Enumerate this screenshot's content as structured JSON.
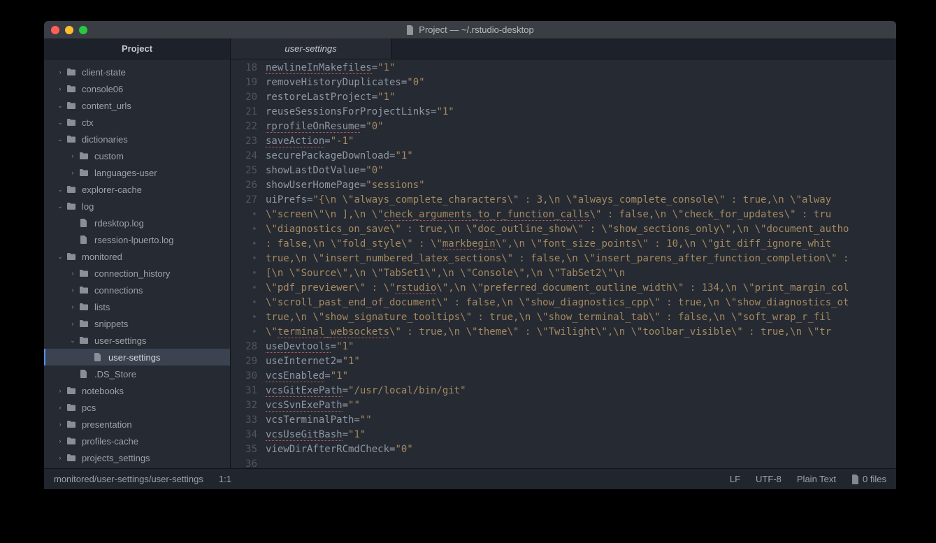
{
  "window_title": "Project — ~/.rstudio-desktop",
  "sidebar_title": "Project",
  "tab_label": "user-settings",
  "tree": [
    {
      "depth": 0,
      "type": "folder",
      "open": 0,
      "chev": ">",
      "label": "client-state"
    },
    {
      "depth": 0,
      "type": "folder",
      "open": 0,
      "chev": ">",
      "label": "console06"
    },
    {
      "depth": 0,
      "type": "folder",
      "open": 1,
      "chev": "v",
      "label": "content_urls"
    },
    {
      "depth": 0,
      "type": "folder",
      "open": 1,
      "chev": "v",
      "label": "ctx"
    },
    {
      "depth": 0,
      "type": "folder",
      "open": 1,
      "chev": "v",
      "label": "dictionaries"
    },
    {
      "depth": 1,
      "type": "folder",
      "open": 0,
      "chev": ">",
      "label": "custom"
    },
    {
      "depth": 1,
      "type": "folder",
      "open": 0,
      "chev": ">",
      "label": "languages-user"
    },
    {
      "depth": 0,
      "type": "folder",
      "open": 1,
      "chev": "v",
      "label": "explorer-cache"
    },
    {
      "depth": 0,
      "type": "folder",
      "open": 1,
      "chev": "v",
      "label": "log"
    },
    {
      "depth": 1,
      "type": "file",
      "chev": "",
      "label": "rdesktop.log"
    },
    {
      "depth": 1,
      "type": "file",
      "chev": "",
      "label": "rsession-lpuerto.log"
    },
    {
      "depth": 0,
      "type": "folder",
      "open": 1,
      "chev": "v",
      "label": "monitored"
    },
    {
      "depth": 1,
      "type": "folder",
      "open": 0,
      "chev": ">",
      "label": "connection_history"
    },
    {
      "depth": 1,
      "type": "folder",
      "open": 0,
      "chev": ">",
      "label": "connections"
    },
    {
      "depth": 1,
      "type": "folder",
      "open": 0,
      "chev": ">",
      "label": "lists"
    },
    {
      "depth": 1,
      "type": "folder",
      "open": 0,
      "chev": ">",
      "label": "snippets"
    },
    {
      "depth": 1,
      "type": "folder",
      "open": 1,
      "chev": "v",
      "label": "user-settings"
    },
    {
      "depth": 2,
      "type": "file",
      "chev": "",
      "label": "user-settings",
      "active": true
    },
    {
      "depth": 1,
      "type": "file",
      "chev": "",
      "label": ".DS_Store"
    },
    {
      "depth": 0,
      "type": "folder",
      "open": 0,
      "chev": ">",
      "label": "notebooks"
    },
    {
      "depth": 0,
      "type": "folder",
      "open": 0,
      "chev": ">",
      "label": "pcs"
    },
    {
      "depth": 0,
      "type": "folder",
      "open": 0,
      "chev": ">",
      "label": "presentation"
    },
    {
      "depth": 0,
      "type": "folder",
      "open": 0,
      "chev": ">",
      "label": "profiles-cache"
    },
    {
      "depth": 0,
      "type": "folder",
      "open": 0,
      "chev": ">",
      "label": "projects_settings"
    }
  ],
  "code": [
    {
      "n": "18",
      "seg": [
        {
          "t": "newlineInMakefiles",
          "s": 1
        },
        {
          "t": "="
        },
        {
          "t": "\"1\"",
          "c": "str"
        }
      ]
    },
    {
      "n": "19",
      "seg": [
        {
          "t": "removeHistoryDuplicates="
        },
        {
          "t": "\"0\"",
          "c": "str"
        }
      ]
    },
    {
      "n": "20",
      "seg": [
        {
          "t": "restoreLastProject="
        },
        {
          "t": "\"1\"",
          "c": "str"
        }
      ]
    },
    {
      "n": "21",
      "seg": [
        {
          "t": "reuseSessionsForProjectLinks="
        },
        {
          "t": "\"1\"",
          "c": "str"
        }
      ]
    },
    {
      "n": "22",
      "seg": [
        {
          "t": "rprofileOnResume",
          "s": 1
        },
        {
          "t": "="
        },
        {
          "t": "\"0\"",
          "c": "str"
        }
      ]
    },
    {
      "n": "23",
      "seg": [
        {
          "t": "saveAction",
          "s": 1
        },
        {
          "t": "="
        },
        {
          "t": "\"-1\"",
          "c": "str"
        }
      ]
    },
    {
      "n": "24",
      "seg": [
        {
          "t": "securePackageDownload="
        },
        {
          "t": "\"1\"",
          "c": "str"
        }
      ]
    },
    {
      "n": "25",
      "seg": [
        {
          "t": "showLastDotValue="
        },
        {
          "t": "\"0\"",
          "c": "str"
        }
      ]
    },
    {
      "n": "26",
      "seg": [
        {
          "t": "showUserHomePage="
        },
        {
          "t": "\"sessions\"",
          "c": "str"
        }
      ]
    },
    {
      "n": "27",
      "seg": [
        {
          "t": "uiPrefs="
        },
        {
          "t": "\"{\\n    \\\"always_complete_characters\\\" : 3,\\n    \\\"always_complete_console\\\" : true,\\n    \\\"alway",
          "c": "str"
        }
      ]
    },
    {
      "n": "•",
      "seg": [
        {
          "t": "\\\"screen\\\"\\n    ],\\n    \\\"",
          "c": "str"
        },
        {
          "t": "check_arguments_to_r_function_calls",
          "c": "str",
          "s": 1
        },
        {
          "t": "\\\" : false,\\n    \\\"check_for_updates\\\" : tru",
          "c": "str"
        }
      ]
    },
    {
      "n": "•",
      "seg": [
        {
          "t": "\\\"diagnostics_on_save\\\" : true,\\n    \\\"doc_outline_show\\\" : \\\"show_sections_only\\\",\\n    \\\"document_autho",
          "c": "str"
        }
      ]
    },
    {
      "n": "•",
      "seg": [
        {
          "t": ": false,\\n    \\\"fold_style\\\" : \\\"",
          "c": "str"
        },
        {
          "t": "markbegin",
          "c": "str",
          "s": 1
        },
        {
          "t": "\\\",\\n    \\\"font_size_points\\\" : 10,\\n    \\\"git_diff_ignore_whit",
          "c": "str"
        }
      ]
    },
    {
      "n": "•",
      "seg": [
        {
          "t": "true,\\n    \\\"insert_numbered_latex_sections\\\" : false,\\n    \\\"insert_parens_after_function_completion\\\" :",
          "c": "str"
        }
      ]
    },
    {
      "n": "•",
      "seg": [
        {
          "t": "[\\n            \\\"Source\\\",\\n            \\\"TabSet1\\\",\\n            \\\"Console\\\",\\n            \\\"TabSet2\\\"\\n",
          "c": "str"
        }
      ]
    },
    {
      "n": "•",
      "seg": [
        {
          "t": "\\\"pdf_previewer\\\" : \\\"",
          "c": "str"
        },
        {
          "t": "rstudio",
          "c": "str",
          "s": 1
        },
        {
          "t": "\\\",\\n    \\\"preferred_document_outline_width\\\" : 134,\\n    \\\"print_margin_col",
          "c": "str"
        }
      ]
    },
    {
      "n": "•",
      "seg": [
        {
          "t": "\\\"scroll_past_end_of_document\\\" : false,\\n    \\\"show_diagnostics_cpp\\\" : true,\\n    \\\"show_diagnostics_ot",
          "c": "str"
        }
      ]
    },
    {
      "n": "•",
      "seg": [
        {
          "t": "true,\\n    \\\"show_signature_tooltips\\\" : true,\\n    \\\"show_terminal_tab\\\" : false,\\n    \\\"soft_wrap_r_fil",
          "c": "str"
        }
      ]
    },
    {
      "n": "•",
      "seg": [
        {
          "t": "\\\"",
          "c": "str"
        },
        {
          "t": "terminal_websockets",
          "c": "str",
          "s": 1
        },
        {
          "t": "\\\" : true,\\n    \\\"theme\\\" : \\\"Twilight\\\",\\n    \\\"toolbar_visible\\\" : true,\\n    \\\"tr",
          "c": "str"
        }
      ]
    },
    {
      "n": "28",
      "seg": [
        {
          "t": "useDevtools",
          "s": 1
        },
        {
          "t": "="
        },
        {
          "t": "\"1\"",
          "c": "str"
        }
      ]
    },
    {
      "n": "29",
      "seg": [
        {
          "t": "useInternet2="
        },
        {
          "t": "\"1\"",
          "c": "str"
        }
      ]
    },
    {
      "n": "30",
      "seg": [
        {
          "t": "vcsEnabled",
          "s": 1
        },
        {
          "t": "="
        },
        {
          "t": "\"1\"",
          "c": "str"
        }
      ]
    },
    {
      "n": "31",
      "seg": [
        {
          "t": "vcsGitExePath",
          "s": 1
        },
        {
          "t": "="
        },
        {
          "t": "\"/usr/local/bin/git\"",
          "c": "str"
        }
      ]
    },
    {
      "n": "32",
      "seg": [
        {
          "t": "vcsSvnExePath",
          "s": 1
        },
        {
          "t": "="
        },
        {
          "t": "\"\"",
          "c": "str"
        }
      ]
    },
    {
      "n": "33",
      "seg": [
        {
          "t": "vcsTerminalPath="
        },
        {
          "t": "\"\"",
          "c": "str"
        }
      ]
    },
    {
      "n": "34",
      "seg": [
        {
          "t": "vcsUseGitBash",
          "s": 1
        },
        {
          "t": "="
        },
        {
          "t": "\"1\"",
          "c": "str"
        }
      ]
    },
    {
      "n": "35",
      "seg": [
        {
          "t": "viewDirAfterRCmdCheck="
        },
        {
          "t": "\"0\"",
          "c": "str"
        }
      ]
    },
    {
      "n": "36",
      "seg": [
        {
          "t": " "
        }
      ]
    }
  ],
  "status": {
    "path": "monitored/user-settings/user-settings",
    "position": "1:1",
    "line_ending": "LF",
    "encoding": "UTF-8",
    "grammar": "Plain Text",
    "files": "0 files"
  }
}
